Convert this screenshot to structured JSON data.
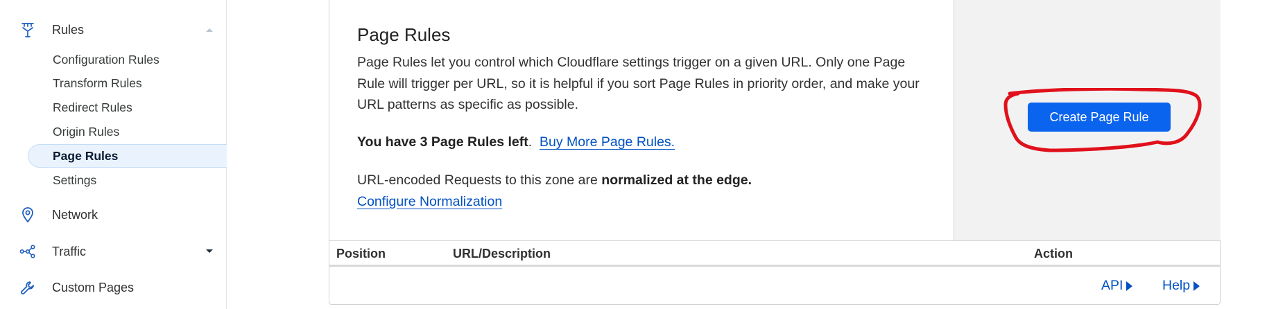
{
  "sidebar": {
    "rules": {
      "label": "Rules",
      "icon": "rules-icon"
    },
    "sub_items": [
      {
        "label": "Configuration Rules",
        "active": false
      },
      {
        "label": "Transform Rules",
        "active": false
      },
      {
        "label": "Redirect Rules",
        "active": false
      },
      {
        "label": "Origin Rules",
        "active": false
      },
      {
        "label": "Page Rules",
        "active": true
      },
      {
        "label": "Settings",
        "active": false
      }
    ],
    "network": {
      "label": "Network",
      "icon": "location-pin-icon"
    },
    "traffic": {
      "label": "Traffic",
      "icon": "traffic-icon"
    },
    "custom_pages": {
      "label": "Custom Pages",
      "icon": "wrench-icon"
    }
  },
  "card": {
    "title": "Page Rules",
    "description": "Page Rules let you control which Cloudflare settings trigger on a given URL. Only one Page Rule will trigger per URL, so it is helpful if you sort Page Rules in priority order, and make your URL patterns as specific as possible.",
    "remaining_text": "You have 3 Page Rules left",
    "remaining_punct": ".",
    "buy_more_link": "Buy More Page Rules.",
    "normalization_text": "URL-encoded Requests to this zone are ",
    "normalization_bold": "normalized at the edge.",
    "configure_link": "Configure Normalization",
    "create_button": "Create Page Rule"
  },
  "table": {
    "columns": [
      "Position",
      "URL/Description",
      "Action"
    ],
    "footer_links": [
      "API",
      "Help"
    ]
  },
  "colors": {
    "accent": "#0a64ee",
    "link": "#0051c3",
    "highlight_annotation": "#e0111b",
    "active_item_bg": "#eaf3fd"
  }
}
